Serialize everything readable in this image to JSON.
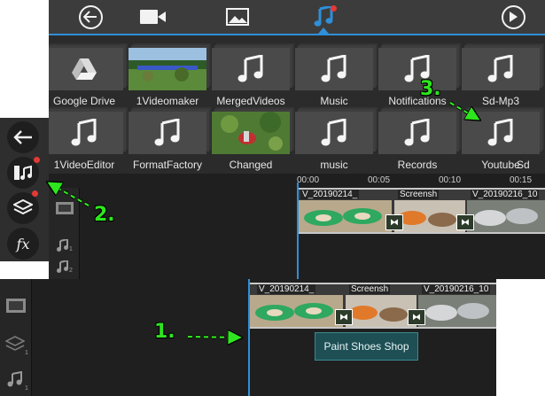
{
  "topbar": {
    "tabs": [
      {
        "icon": "back-icon"
      },
      {
        "icon": "video-icon"
      },
      {
        "icon": "image-icon"
      },
      {
        "icon": "music-icon",
        "active": true,
        "badge": true
      },
      {
        "icon": "play-icon"
      }
    ],
    "accent": "#2f8fd8"
  },
  "folders": [
    {
      "label": "Google Drive",
      "thumb": "google-drive-icon"
    },
    {
      "label": "1Videomaker",
      "thumb": "video-thumbnail"
    },
    {
      "label": "MergedVideos",
      "thumb": "music-note-icon"
    },
    {
      "label": "Music",
      "thumb": "music-note-icon"
    },
    {
      "label": "Notifications",
      "thumb": "music-note-icon"
    },
    {
      "label": "Sd-Mp3",
      "thumb": "music-note-icon"
    },
    {
      "label": "1VideoEditor",
      "thumb": "music-note-icon"
    },
    {
      "label": "FormatFactory",
      "thumb": "music-note-icon"
    },
    {
      "label": "Changed",
      "thumb": "photo-thumbnail"
    },
    {
      "label": "",
      "thumb": "music-note-icon"
    },
    {
      "label": "music",
      "thumb": "music-note-icon"
    },
    {
      "label": "Records",
      "thumb": "music-note-icon"
    },
    {
      "label": "Youtube",
      "thumb": "music-note-icon"
    },
    {
      "label": "Sd",
      "thumb": "music-note-icon"
    }
  ],
  "timeline": {
    "ruler": [
      "00:00",
      "00:05",
      "00:10",
      "00:15"
    ],
    "clips": [
      "V_20190214_",
      "Screensh",
      "V_20190216_10"
    ],
    "title_clip": "Paint Shoes Shop",
    "track_numbers": [
      "1",
      "2"
    ]
  },
  "left_toolbar": {
    "buttons": [
      {
        "name": "back",
        "icon": "back-arrow-icon"
      },
      {
        "name": "media",
        "icon": "media-music-icon",
        "badge": true
      },
      {
        "name": "layers",
        "icon": "layers-icon",
        "badge": true
      },
      {
        "name": "effects",
        "icon": "fx-icon",
        "text": "fx"
      }
    ]
  },
  "annotations": {
    "step1": "1.",
    "step2": "2.",
    "step3": "3.",
    "arrow_color": "#2ee61e"
  }
}
